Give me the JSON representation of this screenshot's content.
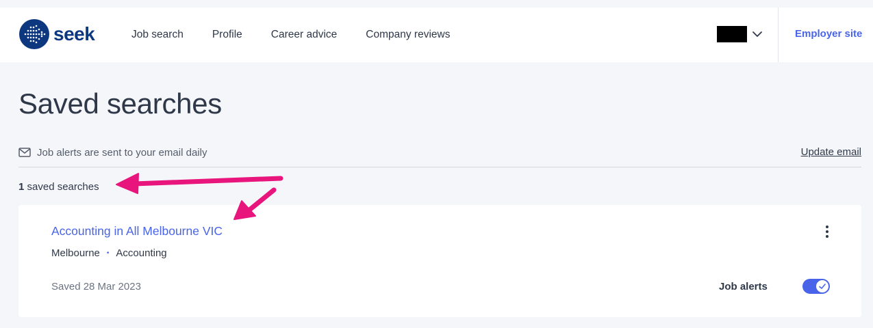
{
  "header": {
    "logo_text": "seek",
    "nav": [
      {
        "label": "Job search"
      },
      {
        "label": "Profile"
      },
      {
        "label": "Career advice"
      },
      {
        "label": "Company reviews"
      }
    ],
    "employer_link": "Employer site"
  },
  "page": {
    "title": "Saved searches",
    "email_note": "Job alerts are sent to your email daily",
    "update_email": "Update email",
    "count_number": "1",
    "count_label": " saved searches"
  },
  "saved_search": {
    "title": "Accounting in All Melbourne VIC",
    "location": "Melbourne",
    "separator": "•",
    "category": "Accounting",
    "saved_date": "Saved 28 Mar 2023",
    "alerts_label": "Job alerts",
    "alerts_enabled": true
  },
  "colors": {
    "brand": "#0d3880",
    "link": "#4964e9",
    "annotation": "#e8157d"
  },
  "icons": [
    "seek-logo-icon",
    "chevron-down-icon",
    "mail-icon",
    "more-vertical-icon",
    "check-icon",
    "annotation-arrow"
  ]
}
